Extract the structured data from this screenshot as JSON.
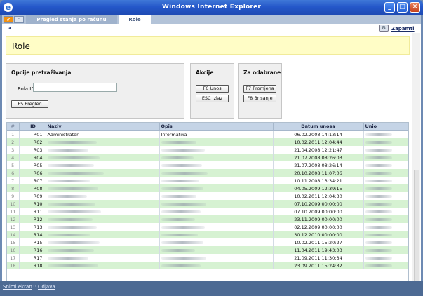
{
  "window": {
    "title": "Windows Internet Explorer"
  },
  "tabs": [
    {
      "label": "Pregled stanja po računu"
    },
    {
      "label": "Role"
    }
  ],
  "toolbar": {
    "zapamti_label": "Zapamti"
  },
  "page": {
    "title": "Role"
  },
  "search_panel": {
    "title": "Opcije pretraživanja",
    "field_label": "Rola ID",
    "field_value": "",
    "button_label": "F5 Pregled"
  },
  "actions_panel": {
    "title": "Akcije",
    "buttons": [
      "F6 Unos",
      "ESC Izlaz"
    ]
  },
  "selected_panel": {
    "title": "Za odabrane",
    "buttons": [
      "F7 Promjena",
      "F8 Brisanje"
    ]
  },
  "grid": {
    "columns": [
      "#",
      "ID",
      "Naziv",
      "Opis",
      "Datum unosa",
      "Unio"
    ],
    "rows": [
      {
        "n": "1",
        "id": "R01",
        "naziv": "Administrator",
        "opis": "Informatika",
        "date": "06.02.2008 14:13:14"
      },
      {
        "n": "2",
        "id": "R02",
        "naziv": "",
        "opis": "",
        "date": "10.02.2011 12:04:44"
      },
      {
        "n": "3",
        "id": "R03",
        "naziv": "",
        "opis": "",
        "date": "21.04.2008 12:21:47"
      },
      {
        "n": "4",
        "id": "R04",
        "naziv": "",
        "opis": "",
        "date": "21.07.2008 08:26:03"
      },
      {
        "n": "5",
        "id": "R05",
        "naziv": "",
        "opis": "",
        "date": "21.07.2008 08:26:14"
      },
      {
        "n": "6",
        "id": "R06",
        "naziv": "",
        "opis": "",
        "date": "20.10.2008 11:07:06"
      },
      {
        "n": "7",
        "id": "R07",
        "naziv": "",
        "opis": "",
        "date": "10.11.2008 13:34:21"
      },
      {
        "n": "8",
        "id": "R08",
        "naziv": "",
        "opis": "",
        "date": "04.05.2009 12:39:15"
      },
      {
        "n": "9",
        "id": "R09",
        "naziv": "",
        "opis": "",
        "date": "10.02.2011 12:04:30"
      },
      {
        "n": "10",
        "id": "R10",
        "naziv": "",
        "opis": "",
        "date": "07.10.2009 00:00:00"
      },
      {
        "n": "11",
        "id": "R11",
        "naziv": "",
        "opis": "",
        "date": "07.10.2009 00:00:00"
      },
      {
        "n": "12",
        "id": "R12",
        "naziv": "",
        "opis": "",
        "date": "23.11.2009 00:00:00"
      },
      {
        "n": "13",
        "id": "R13",
        "naziv": "",
        "opis": "",
        "date": "02.12.2009 00:00:00"
      },
      {
        "n": "14",
        "id": "R14",
        "naziv": "",
        "opis": "",
        "date": "30.12.2010 00:00:00"
      },
      {
        "n": "15",
        "id": "R15",
        "naziv": "",
        "opis": "",
        "date": "10.02.2011 15:20:27"
      },
      {
        "n": "16",
        "id": "R16",
        "naziv": "",
        "opis": "",
        "date": "11.04.2011 19:43:03"
      },
      {
        "n": "17",
        "id": "R17",
        "naziv": "",
        "opis": "",
        "date": "21.09.2011 11:30:34"
      },
      {
        "n": "18",
        "id": "R18",
        "naziv": "",
        "opis": "",
        "date": "23.09.2011 15:24:32"
      }
    ]
  },
  "statusbar": {
    "links": [
      "Snimi ekran",
      "Odjava"
    ],
    "separator": "::"
  },
  "colors": {
    "banner": "#fffdc6",
    "row_alt": "#d6f2d2",
    "header": "#c5d4e6",
    "titlebar": "#2457c9"
  }
}
